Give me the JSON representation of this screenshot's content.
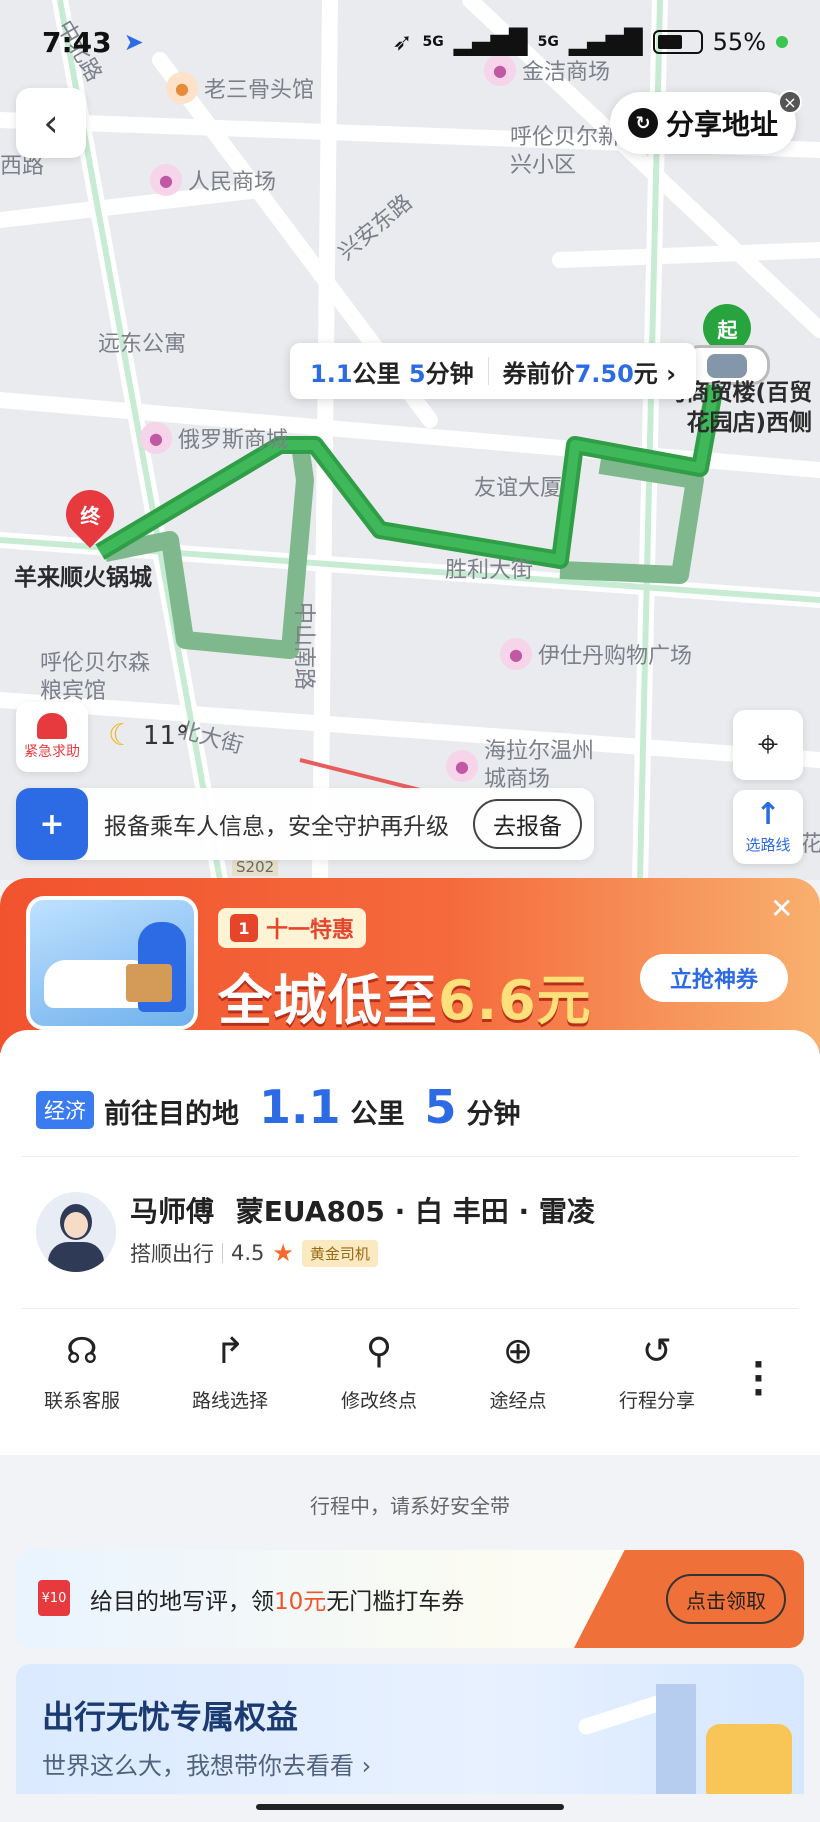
{
  "status_bar": {
    "time": "7:43",
    "network_1": "5G",
    "network_2": "5G",
    "battery": "55%",
    "battery_level": 0.55
  },
  "map": {
    "labels": {
      "road_1": "中北路",
      "road_2": "兴安东路",
      "road_3": "胜利大街",
      "road_4": "北大街",
      "road_5": "中山南路",
      "road_6": "西路",
      "road_7": "S202",
      "road_8": "花",
      "area_1": "呼伦贝尔新兴小区",
      "area_2": "远东公寓",
      "area_3": "友谊大厦",
      "area_4": "呼伦贝尔森粮宾馆"
    },
    "pois": {
      "poi_1": "老三骨头馆",
      "poi_2": "金洁商场",
      "poi_3": "人民商场",
      "poi_4": "俄罗斯商城",
      "poi_5": "伊仕丹购物广场",
      "poi_6": "海拉尔温州城商场"
    },
    "start_marker": "起",
    "end_marker": "终",
    "start_name": "马商贸楼(百贸花园店)西侧",
    "end_name": "羊来顺火锅城",
    "route_bubble": {
      "distance_value": "1.1",
      "distance_unit": "公里",
      "time_value": "5",
      "time_unit": "分钟",
      "price_label": "券前价",
      "price_value": "7.50",
      "price_unit": "元"
    },
    "share_button": "分享地址",
    "emergency": "紧急求助",
    "weather_temp": "11°",
    "route_select": "选路线",
    "safety_text": "报备乘车人信息，安全守护再升级",
    "safety_button": "去报备"
  },
  "promo": {
    "tag": "十一特惠",
    "calendar_day": "1",
    "headline_prefix": "全城低至",
    "headline_amount": "6.6元",
    "cta": "立抢神券"
  },
  "trip": {
    "badge": "经济",
    "destination_label": "前往目的地",
    "distance_value": "1.1",
    "distance_unit": "公里",
    "time_value": "5",
    "time_unit": "分钟",
    "driver_name": "马师傅",
    "plate": "蒙EUA805",
    "car": "· 白  丰田 · 雷凌",
    "platform": "搭顺出行",
    "rating": "4.5",
    "driver_level": "黄金司机",
    "actions": [
      {
        "label": "联系客服",
        "icon": "headset-icon"
      },
      {
        "label": "路线选择",
        "icon": "route-icon"
      },
      {
        "label": "修改终点",
        "icon": "edit-destination-icon"
      },
      {
        "label": "途经点",
        "icon": "waypoint-icon"
      },
      {
        "label": "行程分享",
        "icon": "share-trip-icon"
      }
    ]
  },
  "seatbelt_notice": "行程中，请系好安全带",
  "coupon": {
    "icon_text": "¥10",
    "text_before": "给目的地写评，领",
    "text_amount": "10元",
    "text_after": "无门槛打车券",
    "button": "点击领取"
  },
  "benefits": {
    "title": "出行无忧专属权益",
    "subtitle": "世界这么大，我想带你去看看 ›"
  },
  "colors": {
    "accent_blue": "#2d6be4",
    "route_green": "#27a43e",
    "alert_red": "#e63a3f",
    "promo_orange": "#f1532e"
  }
}
